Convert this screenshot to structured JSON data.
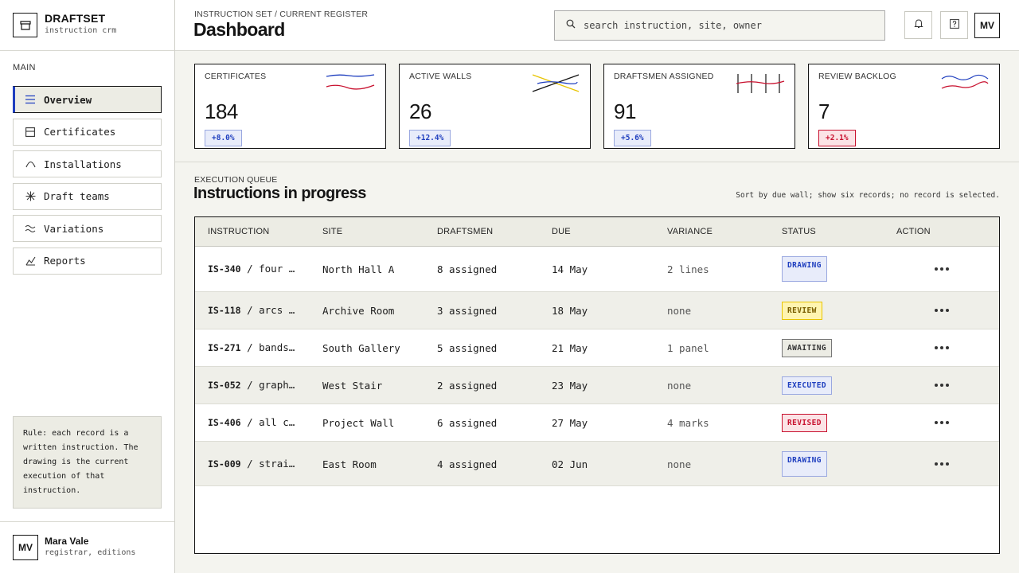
{
  "brand": {
    "name": "DRAFTSET",
    "subtitle": "instruction crm"
  },
  "sidebar": {
    "section_label": "MAIN",
    "items": [
      {
        "label": "Overview",
        "icon": "list-icon",
        "active": true
      },
      {
        "label": "Certificates",
        "icon": "certificate-icon",
        "active": false
      },
      {
        "label": "Installations",
        "icon": "arch-icon",
        "active": false
      },
      {
        "label": "Draft teams",
        "icon": "asterisk-icon",
        "active": false
      },
      {
        "label": "Variations",
        "icon": "waves-icon",
        "active": false
      },
      {
        "label": "Reports",
        "icon": "chart-icon",
        "active": false
      }
    ],
    "rule_text": "Rule: each record is a written instruction. The drawing is the current execution of that instruction.",
    "user": {
      "initials": "MV",
      "name": "Mara Vale",
      "role": "registrar, editions"
    }
  },
  "header": {
    "breadcrumb": "INSTRUCTION SET / CURRENT REGISTER",
    "title": "Dashboard",
    "search_placeholder": "search instruction, site, owner",
    "avatar_initials": "MV"
  },
  "kpis": [
    {
      "label": "CERTIFICATES",
      "value": "184",
      "delta": "+8.0%",
      "tone": "blue"
    },
    {
      "label": "ACTIVE WALLS",
      "value": "26",
      "delta": "+12.4%",
      "tone": "blue"
    },
    {
      "label": "DRAFTSMEN ASSIGNED",
      "value": "91",
      "delta": "+5.6%",
      "tone": "blue"
    },
    {
      "label": "REVIEW BACKLOG",
      "value": "7",
      "delta": "+2.1%",
      "tone": "red"
    }
  ],
  "queue": {
    "eyebrow": "EXECUTION QUEUE",
    "title": "Instructions in progress",
    "note": "Sort by due wall; show six records; no record is selected.",
    "columns": [
      "INSTRUCTION",
      "SITE",
      "DRAFTSMEN",
      "DUE",
      "VARIANCE",
      "STATUS",
      "ACTION"
    ],
    "rows": [
      {
        "id": "IS-340",
        "text": "/ four …",
        "site": "North Hall A",
        "draftsmen": "8 assigned",
        "due": "14 May",
        "variance": "2 lines",
        "status": "DRAWING",
        "status_tone": "blue"
      },
      {
        "id": "IS-118",
        "text": "/ arcs …",
        "site": "Archive Room",
        "draftsmen": "3 assigned",
        "due": "18 May",
        "variance": "none",
        "status": "REVIEW",
        "status_tone": "yellow"
      },
      {
        "id": "IS-271",
        "text": "/ bands…",
        "site": "South Gallery",
        "draftsmen": "5 assigned",
        "due": "21 May",
        "variance": "1 panel",
        "status": "AWAITING",
        "status_tone": "gray"
      },
      {
        "id": "IS-052",
        "text": "/ graph…",
        "site": "West Stair",
        "draftsmen": "2 assigned",
        "due": "23 May",
        "variance": "none",
        "status": "EXECUTED",
        "status_tone": "blue"
      },
      {
        "id": "IS-406",
        "text": "/ all c…",
        "site": "Project Wall",
        "draftsmen": "6 assigned",
        "due": "27 May",
        "variance": "4 marks",
        "status": "REVISED",
        "status_tone": "red"
      },
      {
        "id": "IS-009",
        "text": "/ strai…",
        "site": "East Room",
        "draftsmen": "4 assigned",
        "due": "02 Jun",
        "variance": "none",
        "status": "DRAWING",
        "status_tone": "blue"
      }
    ]
  },
  "colors": {
    "accent_blue": "#1f3fbf",
    "accent_red": "#c8102e",
    "accent_yellow": "#e8c400",
    "ink": "#141414"
  }
}
